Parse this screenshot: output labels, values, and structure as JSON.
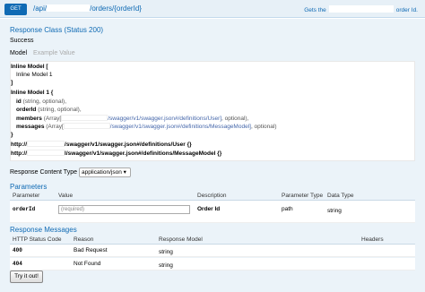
{
  "operation": {
    "method": "GET",
    "path_prefix": "/api/",
    "path_suffix": "/orders/{orderId}",
    "summary_prefix": "Gets the",
    "summary_suffix": "order Id."
  },
  "response_class": {
    "heading": "Response Class (Status 200)",
    "status": "Success"
  },
  "tabs": {
    "model": "Model",
    "example": "Example Value"
  },
  "model": {
    "inline_model": "Inline Model [",
    "inline_model_ref": "Inline Model 1",
    "close_bracket": "]",
    "inline_model_1": "Inline Model 1 {",
    "fields": [
      {
        "name": "id",
        "type": "(string, optional),",
        "prefix": "",
        "suffix": ""
      },
      {
        "name": "orderId",
        "type": "(string, optional),",
        "prefix": "",
        "suffix": ""
      },
      {
        "name": "members",
        "type": "",
        "prefix": "(Array[",
        "suffix": "/swagger/v1/swagger.json#/definitions/User]",
        "tail": ", optional),"
      },
      {
        "name": "messages",
        "type": "",
        "prefix": "(Array[",
        "suffix": "/swagger/v1/swagger.json#/definitions/MessageModel]",
        "tail": ", optional)"
      }
    ],
    "close_brace": "}",
    "def_user_prefix": "http://",
    "def_user_suffix": "/swagger/v1/swagger.json#/definitions/User {}",
    "def_msg_prefix": "http://",
    "def_msg_suffix": "l/swagger/v1/swagger.json#/definitions/MessageModel {}"
  },
  "response_content_type": {
    "label": "Response Content Type",
    "value": "application/json ▾"
  },
  "parameters": {
    "heading": "Parameters",
    "columns": [
      "Parameter",
      "Value",
      "Description",
      "Parameter Type",
      "Data Type"
    ],
    "rows": [
      {
        "name": "orderId",
        "placeholder": "(required)",
        "description": "Order Id",
        "param_type": "path",
        "data_type": "string"
      }
    ]
  },
  "response_messages": {
    "heading": "Response Messages",
    "columns": [
      "HTTP Status Code",
      "Reason",
      "Response Model",
      "Headers"
    ],
    "rows": [
      {
        "code": "400",
        "reason": "Bad Request",
        "model": "string"
      },
      {
        "code": "404",
        "reason": "Not Found",
        "model": "string"
      }
    ]
  },
  "try_button": "Try it out!",
  "colors": {
    "accent": "#0f6ab4",
    "panel": "#ebf3f9",
    "header": "#e7f0f7"
  }
}
